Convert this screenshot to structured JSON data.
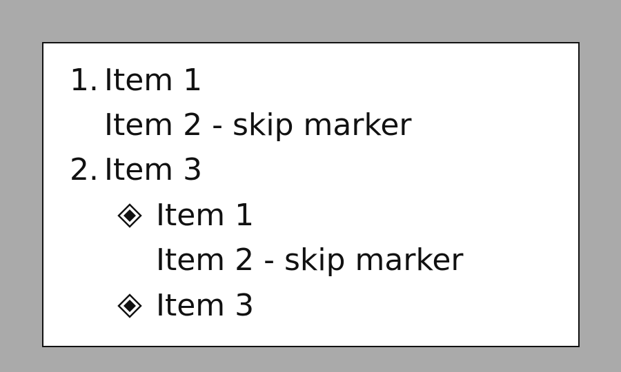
{
  "colors": {
    "page_background": "#aaaaaa",
    "panel_background": "#ffffff",
    "text": "#111111"
  },
  "outer_list": {
    "items": [
      {
        "marker": "1.",
        "text": "Item 1"
      },
      {
        "marker": "",
        "text": "Item 2 - skip marker"
      },
      {
        "marker": "2.",
        "text": "Item 3"
      }
    ]
  },
  "nested_list": {
    "marker_icon": "diamond-in-square-icon",
    "items": [
      {
        "has_marker": true,
        "text": "Item 1"
      },
      {
        "has_marker": false,
        "text": "Item 2 - skip marker"
      },
      {
        "has_marker": true,
        "text": "Item 3"
      }
    ]
  }
}
